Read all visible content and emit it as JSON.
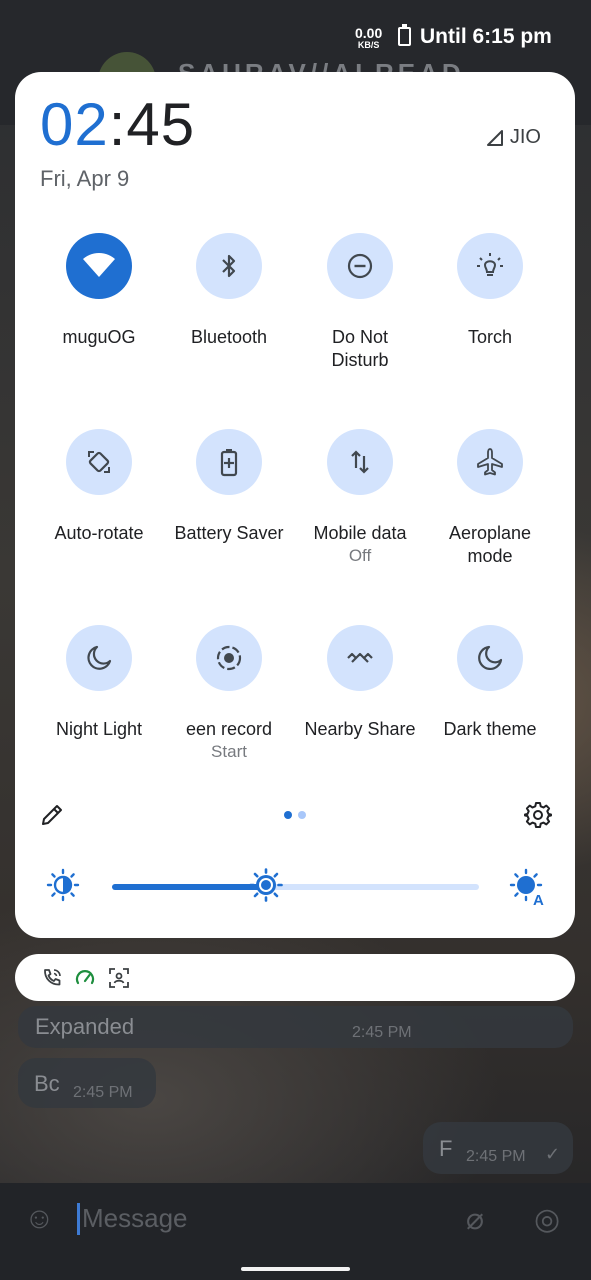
{
  "status_bar": {
    "net_speed_value": "0.00",
    "net_speed_unit": "KB/S",
    "battery_text": "Until 6:15 pm"
  },
  "background_chat": {
    "contact_name": "SAURAV//ALREAD",
    "messages": [
      {
        "text": "Expanded",
        "time": "2:45 PM"
      },
      {
        "text": "Bc",
        "time": "2:45 PM"
      },
      {
        "text": "F",
        "time": "2:45 PM"
      }
    ],
    "input_placeholder": "Message"
  },
  "quick_settings": {
    "clock_hour": "02",
    "clock_sep_min": ":45",
    "date": "Fri, Apr 9",
    "carrier": "JIO",
    "tiles": [
      {
        "label": "muguOG",
        "sub": "",
        "icon": "wifi-icon",
        "active": true
      },
      {
        "label": "Bluetooth",
        "sub": "",
        "icon": "bluetooth-icon",
        "active": false
      },
      {
        "label": "Do Not\nDisturb",
        "sub": "",
        "icon": "do-not-disturb-icon",
        "active": false
      },
      {
        "label": "Torch",
        "sub": "",
        "icon": "torch-icon",
        "active": false
      },
      {
        "label": "Auto-rotate",
        "sub": "",
        "icon": "auto-rotate-icon",
        "active": false
      },
      {
        "label": "Battery Saver",
        "sub": "",
        "icon": "battery-saver-icon",
        "active": false
      },
      {
        "label": "Mobile data",
        "sub": "Off",
        "icon": "mobile-data-icon",
        "active": false
      },
      {
        "label": "Aeroplane\nmode",
        "sub": "",
        "icon": "airplane-icon",
        "active": false
      },
      {
        "label": "Night Light",
        "sub": "",
        "icon": "night-light-icon",
        "active": false
      },
      {
        "label": "een record",
        "sub": "Start",
        "icon": "screen-record-icon",
        "active": false
      },
      {
        "label": "Nearby Share",
        "sub": "",
        "icon": "nearby-share-icon",
        "active": false
      },
      {
        "label": "Dark theme",
        "sub": "",
        "icon": "dark-theme-icon",
        "active": false
      }
    ],
    "page_indicator": {
      "pages": 2,
      "current": 1
    },
    "brightness_level": 0.42,
    "colors": {
      "accent": "#1f6fd1",
      "tile_inactive": "#d3e3fd",
      "panel": "#ffffff"
    }
  },
  "notification_icons": [
    "wifi-calling-icon",
    "speedometer-icon",
    "screenshot-scan-icon"
  ]
}
